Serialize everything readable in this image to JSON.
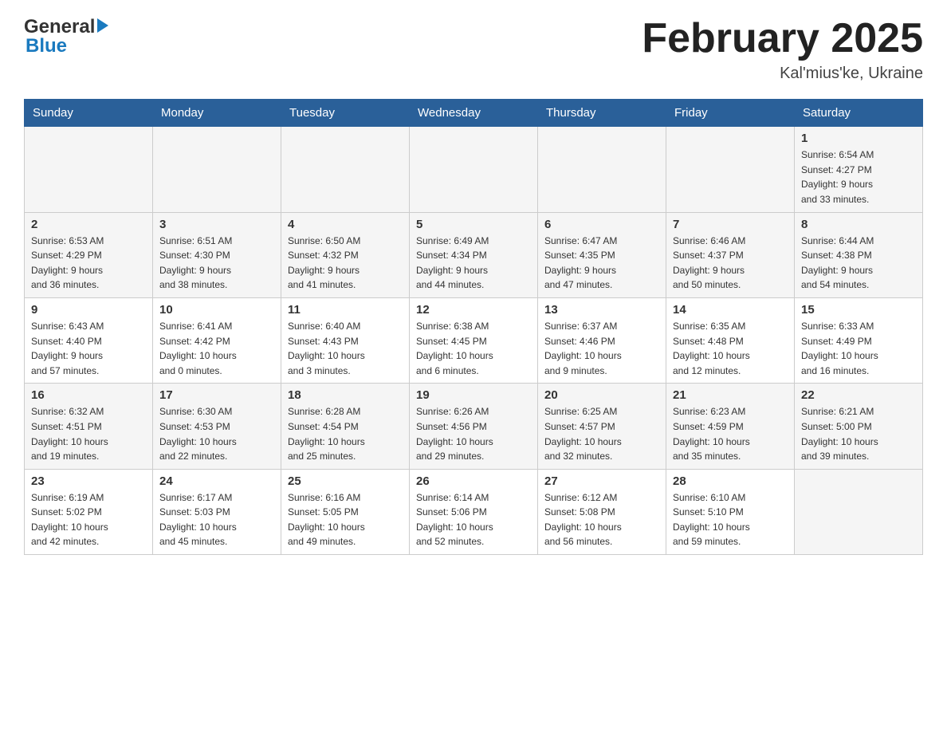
{
  "header": {
    "logo_general": "General",
    "logo_blue": "Blue",
    "title": "February 2025",
    "location": "Kal'mius'ke, Ukraine"
  },
  "weekdays": [
    "Sunday",
    "Monday",
    "Tuesday",
    "Wednesday",
    "Thursday",
    "Friday",
    "Saturday"
  ],
  "weeks": [
    {
      "days": [
        {
          "num": "",
          "info": ""
        },
        {
          "num": "",
          "info": ""
        },
        {
          "num": "",
          "info": ""
        },
        {
          "num": "",
          "info": ""
        },
        {
          "num": "",
          "info": ""
        },
        {
          "num": "",
          "info": ""
        },
        {
          "num": "1",
          "info": "Sunrise: 6:54 AM\nSunset: 4:27 PM\nDaylight: 9 hours\nand 33 minutes."
        }
      ]
    },
    {
      "days": [
        {
          "num": "2",
          "info": "Sunrise: 6:53 AM\nSunset: 4:29 PM\nDaylight: 9 hours\nand 36 minutes."
        },
        {
          "num": "3",
          "info": "Sunrise: 6:51 AM\nSunset: 4:30 PM\nDaylight: 9 hours\nand 38 minutes."
        },
        {
          "num": "4",
          "info": "Sunrise: 6:50 AM\nSunset: 4:32 PM\nDaylight: 9 hours\nand 41 minutes."
        },
        {
          "num": "5",
          "info": "Sunrise: 6:49 AM\nSunset: 4:34 PM\nDaylight: 9 hours\nand 44 minutes."
        },
        {
          "num": "6",
          "info": "Sunrise: 6:47 AM\nSunset: 4:35 PM\nDaylight: 9 hours\nand 47 minutes."
        },
        {
          "num": "7",
          "info": "Sunrise: 6:46 AM\nSunset: 4:37 PM\nDaylight: 9 hours\nand 50 minutes."
        },
        {
          "num": "8",
          "info": "Sunrise: 6:44 AM\nSunset: 4:38 PM\nDaylight: 9 hours\nand 54 minutes."
        }
      ]
    },
    {
      "days": [
        {
          "num": "9",
          "info": "Sunrise: 6:43 AM\nSunset: 4:40 PM\nDaylight: 9 hours\nand 57 minutes."
        },
        {
          "num": "10",
          "info": "Sunrise: 6:41 AM\nSunset: 4:42 PM\nDaylight: 10 hours\nand 0 minutes."
        },
        {
          "num": "11",
          "info": "Sunrise: 6:40 AM\nSunset: 4:43 PM\nDaylight: 10 hours\nand 3 minutes."
        },
        {
          "num": "12",
          "info": "Sunrise: 6:38 AM\nSunset: 4:45 PM\nDaylight: 10 hours\nand 6 minutes."
        },
        {
          "num": "13",
          "info": "Sunrise: 6:37 AM\nSunset: 4:46 PM\nDaylight: 10 hours\nand 9 minutes."
        },
        {
          "num": "14",
          "info": "Sunrise: 6:35 AM\nSunset: 4:48 PM\nDaylight: 10 hours\nand 12 minutes."
        },
        {
          "num": "15",
          "info": "Sunrise: 6:33 AM\nSunset: 4:49 PM\nDaylight: 10 hours\nand 16 minutes."
        }
      ]
    },
    {
      "days": [
        {
          "num": "16",
          "info": "Sunrise: 6:32 AM\nSunset: 4:51 PM\nDaylight: 10 hours\nand 19 minutes."
        },
        {
          "num": "17",
          "info": "Sunrise: 6:30 AM\nSunset: 4:53 PM\nDaylight: 10 hours\nand 22 minutes."
        },
        {
          "num": "18",
          "info": "Sunrise: 6:28 AM\nSunset: 4:54 PM\nDaylight: 10 hours\nand 25 minutes."
        },
        {
          "num": "19",
          "info": "Sunrise: 6:26 AM\nSunset: 4:56 PM\nDaylight: 10 hours\nand 29 minutes."
        },
        {
          "num": "20",
          "info": "Sunrise: 6:25 AM\nSunset: 4:57 PM\nDaylight: 10 hours\nand 32 minutes."
        },
        {
          "num": "21",
          "info": "Sunrise: 6:23 AM\nSunset: 4:59 PM\nDaylight: 10 hours\nand 35 minutes."
        },
        {
          "num": "22",
          "info": "Sunrise: 6:21 AM\nSunset: 5:00 PM\nDaylight: 10 hours\nand 39 minutes."
        }
      ]
    },
    {
      "days": [
        {
          "num": "23",
          "info": "Sunrise: 6:19 AM\nSunset: 5:02 PM\nDaylight: 10 hours\nand 42 minutes."
        },
        {
          "num": "24",
          "info": "Sunrise: 6:17 AM\nSunset: 5:03 PM\nDaylight: 10 hours\nand 45 minutes."
        },
        {
          "num": "25",
          "info": "Sunrise: 6:16 AM\nSunset: 5:05 PM\nDaylight: 10 hours\nand 49 minutes."
        },
        {
          "num": "26",
          "info": "Sunrise: 6:14 AM\nSunset: 5:06 PM\nDaylight: 10 hours\nand 52 minutes."
        },
        {
          "num": "27",
          "info": "Sunrise: 6:12 AM\nSunset: 5:08 PM\nDaylight: 10 hours\nand 56 minutes."
        },
        {
          "num": "28",
          "info": "Sunrise: 6:10 AM\nSunset: 5:10 PM\nDaylight: 10 hours\nand 59 minutes."
        },
        {
          "num": "",
          "info": ""
        }
      ]
    }
  ]
}
